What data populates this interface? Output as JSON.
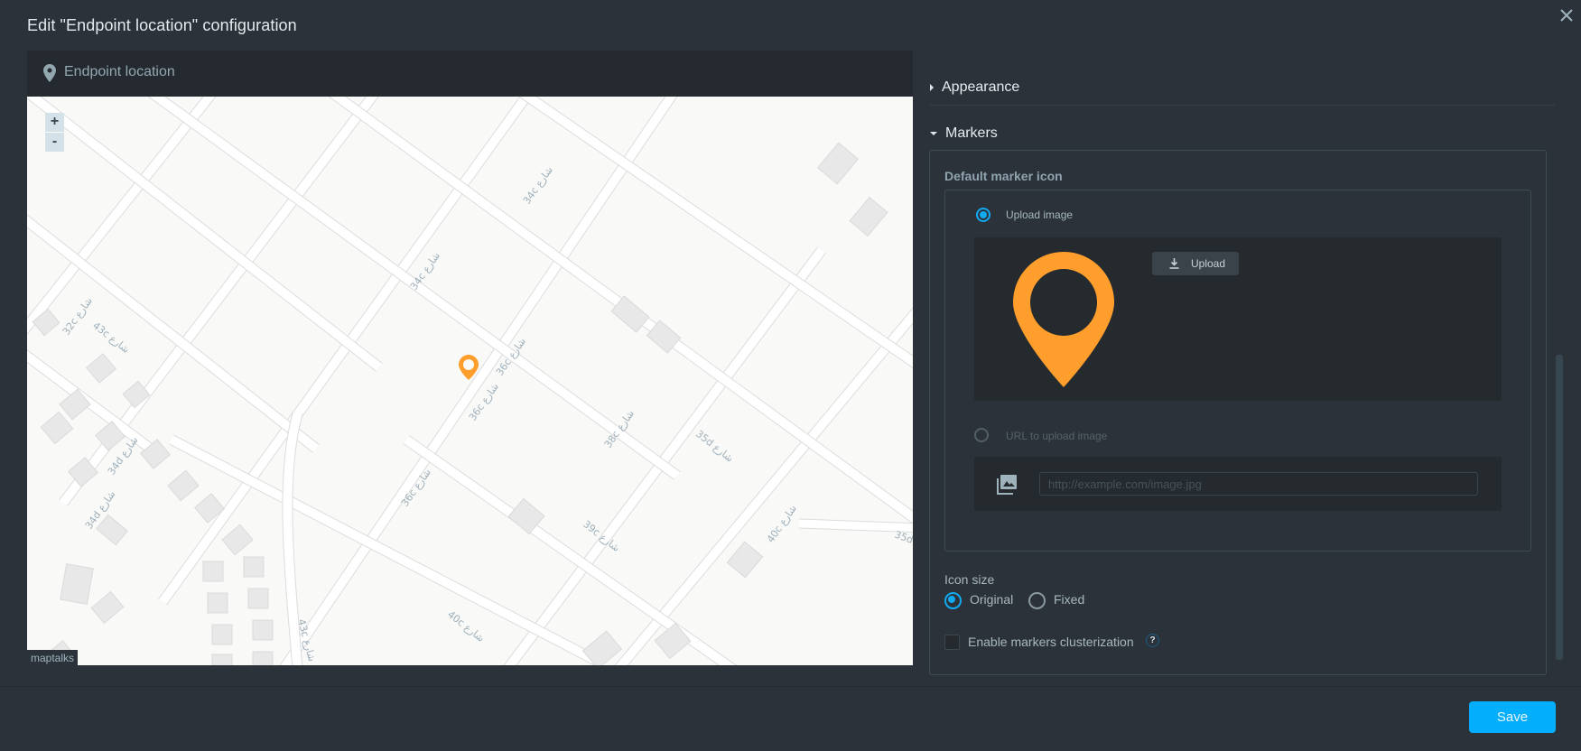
{
  "dialog": {
    "title": "Edit \"Endpoint location\" configuration",
    "close_icon": "close-icon"
  },
  "map_panel": {
    "header_icon": "map-pin-icon",
    "header_label": "Endpoint location",
    "zoom_in_label": "+",
    "zoom_out_label": "-",
    "attribution": "maptalks",
    "marker_color": "#ff9e2c",
    "street_labels": [
      {
        "text": "34c شارع",
        "id": "street-34c-a"
      },
      {
        "text": "34c شارع",
        "id": "street-34c-b"
      },
      {
        "text": "43c شارع",
        "id": "street-43c-a"
      },
      {
        "text": "32c شارع",
        "id": "street-32c"
      },
      {
        "text": "34d شارع",
        "id": "street-34d-a"
      },
      {
        "text": "34d شارع",
        "id": "street-34d-b"
      },
      {
        "text": "36c شارع",
        "id": "street-36c-a"
      },
      {
        "text": "36c شارع",
        "id": "street-36c-b"
      },
      {
        "text": "36c شارع",
        "id": "street-36c-c"
      },
      {
        "text": "38c شارع",
        "id": "street-38c"
      },
      {
        "text": "35d شارع",
        "id": "street-35d"
      },
      {
        "text": "39c شارع",
        "id": "street-39c"
      },
      {
        "text": "40c شارع",
        "id": "street-40c-a"
      },
      {
        "text": "40c شارع",
        "id": "street-40c-b"
      },
      {
        "text": "43c شارع",
        "id": "street-43c-b"
      },
      {
        "text": "35d",
        "id": "street-35d-b"
      }
    ]
  },
  "settings": {
    "sections": [
      {
        "label": "Appearance",
        "expanded": false
      },
      {
        "label": "Markers",
        "expanded": true
      }
    ],
    "markers": {
      "default_marker_icon_label": "Default marker icon",
      "upload_image_label": "Upload image",
      "upload_image_selected": true,
      "upload_button_label": "Upload",
      "upload_icon": "download-icon",
      "preview_marker_color": "#ff9e2c",
      "url_option_label": "URL to upload image",
      "url_option_selected": false,
      "url_icon": "image-library-icon",
      "url_input_value": "",
      "url_input_placeholder": "http://example.com/image.jpg",
      "icon_size_label": "Icon size",
      "icon_size_options": [
        {
          "label": "Original",
          "selected": true
        },
        {
          "label": "Fixed",
          "selected": false
        }
      ],
      "clusterization_label": "Enable markers clusterization",
      "clusterization_checked": false,
      "help_label": "?"
    }
  },
  "footer": {
    "save_label": "Save"
  },
  "colors": {
    "accent": "#03aefd",
    "radio_selected": "#11aaf2",
    "background": "#2b323a"
  }
}
